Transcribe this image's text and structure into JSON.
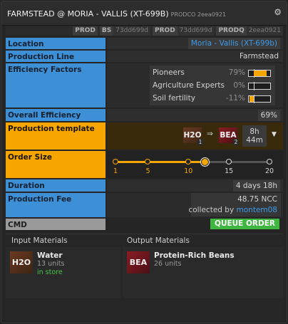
{
  "window": {
    "title": "FARMSTEAD @ MORIA - VALLIS (XT-699B)",
    "subtitle": "PRODCO 2eea0921"
  },
  "tags": [
    {
      "key": "PROD",
      "value": ""
    },
    {
      "key": "BS",
      "value": "73dd699d"
    },
    {
      "key": "PROD",
      "value": "73dd699d"
    },
    {
      "key": "PRODQ",
      "value": "2eea0921"
    }
  ],
  "rows": {
    "location": {
      "label": "Location",
      "value": "Moria - Vallis (XT-699b)"
    },
    "production_line": {
      "label": "Production Line",
      "value": "Farmstead"
    },
    "efficiency_factors": {
      "label": "Efficiency Factors",
      "factors": [
        {
          "name": "Pioneers",
          "value": "79%",
          "level": 0.79
        },
        {
          "name": "Agriculture Experts",
          "value": "0%",
          "level": 0.0
        },
        {
          "name": "Soil fertility",
          "value": "-11%",
          "level": -0.11
        }
      ]
    },
    "overall_efficiency": {
      "label": "Overall Efficiency",
      "value": "69%"
    },
    "production_template": {
      "label": "Production template",
      "input": {
        "ticker": "H2O",
        "amount": "1"
      },
      "arrow": "⇒",
      "output": {
        "ticker": "BEA",
        "amount": "2"
      },
      "duration_line1": "8h",
      "duration_line2": "44m",
      "dropdown": "▼"
    },
    "order_size": {
      "label": "Order Size",
      "ticks": [
        "1",
        "5",
        "10",
        "15",
        "20"
      ],
      "selected": 12
    },
    "duration": {
      "label": "Duration",
      "value": "4 days 18h"
    },
    "production_fee": {
      "label": "Production Fee",
      "amount": "48.75 NCC",
      "collected_prefix": "collected by",
      "collector": "montem08"
    },
    "cmd": {
      "label": "CMD",
      "button": "QUEUE ORDER"
    }
  },
  "materials": {
    "input_header": "Input Materials",
    "output_header": "Output Materials",
    "input": {
      "ticker": "H2O",
      "name": "Water",
      "units": "13 units",
      "status": "in store"
    },
    "output": {
      "ticker": "BEA",
      "name": "Protein-Rich Beans",
      "units": "26 units"
    }
  },
  "colors": {
    "label_blue": "#3d8fd6",
    "label_yellow": "#f7a600",
    "queue_green": "#3fb63f",
    "link_blue": "#3d9be9",
    "store_green": "#47c447"
  },
  "icons": [
    "gear-icon",
    "arrow-right-icon",
    "dropdown-caret-icon"
  ]
}
